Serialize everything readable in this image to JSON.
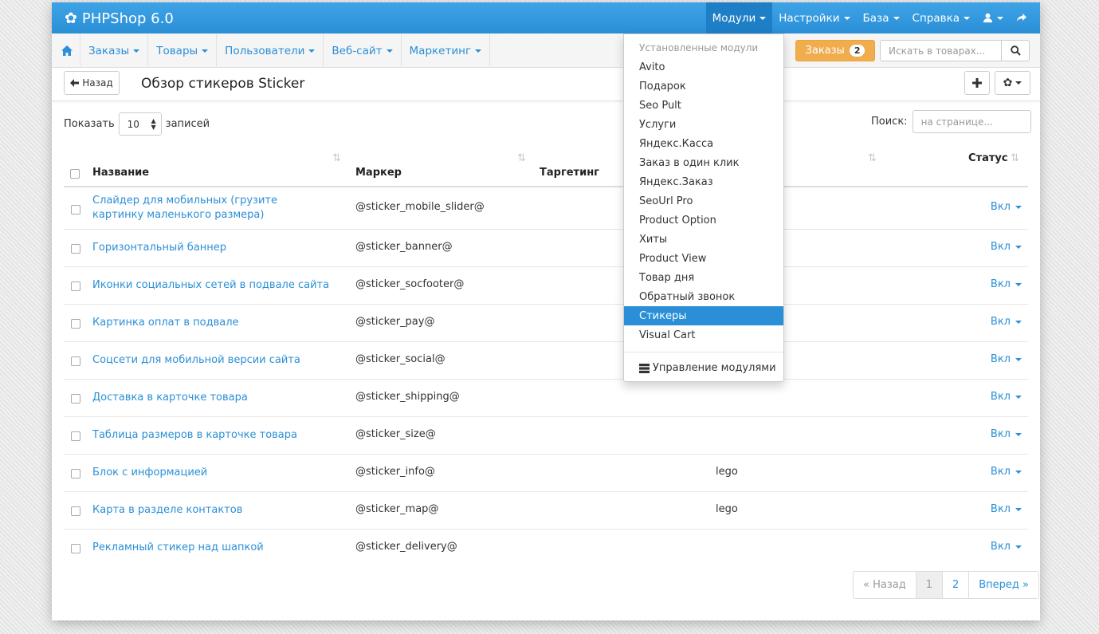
{
  "app": {
    "title": "PHPShop 6.0"
  },
  "topmenu": [
    {
      "label": "Модули",
      "active": true
    },
    {
      "label": "Настройки"
    },
    {
      "label": "База"
    },
    {
      "label": "Справка"
    }
  ],
  "icons": {
    "user": "user-icon",
    "exit": "share-icon",
    "home": "home-icon",
    "search": "search-icon",
    "gear": "gear-icon",
    "plus": "plus-icon",
    "back": "arrow-left-icon",
    "modules": "server-icon"
  },
  "subnav": [
    {
      "label": "Заказы"
    },
    {
      "label": "Товары"
    },
    {
      "label": "Пользователи"
    },
    {
      "label": "Веб-сайт"
    },
    {
      "label": "Маркетинг"
    }
  ],
  "orders_button": {
    "label": "Заказы",
    "count": "2"
  },
  "search": {
    "placeholder": "Искать в товарах..."
  },
  "page": {
    "back_label": "Назад",
    "title": "Обзор стикеров Sticker"
  },
  "controls": {
    "show_label": "Показать",
    "show_value": "10",
    "records_label": "записей",
    "search_label": "Поиск:",
    "search_placeholder": "на странице..."
  },
  "table": {
    "headers": {
      "name": "Название",
      "marker": "Маркер",
      "targeting": "Таргетинг",
      "status": "Статус"
    },
    "rows": [
      {
        "name": "Слайдер для мобильных (грузите картинку маленького размера)",
        "marker": "@sticker_mobile_slider@",
        "targeting": "",
        "status": "Вкл"
      },
      {
        "name": "Горизонтальный баннер",
        "marker": "@sticker_banner@",
        "targeting": "",
        "status": "Вкл"
      },
      {
        "name": "Иконки социальных сетей в подвале сайта",
        "marker": "@sticker_socfooter@",
        "targeting": "",
        "status": "Вкл"
      },
      {
        "name": "Картинка оплат в подвале",
        "marker": "@sticker_pay@",
        "targeting": "",
        "status": "Вкл"
      },
      {
        "name": "Соцсети для мобильной версии сайта",
        "marker": "@sticker_social@",
        "targeting": "",
        "status": "Вкл"
      },
      {
        "name": "Доставка в карточке товара",
        "marker": "@sticker_shipping@",
        "targeting": "",
        "status": "Вкл"
      },
      {
        "name": "Таблица размеров в карточке товара",
        "marker": "@sticker_size@",
        "targeting": "",
        "status": "Вкл"
      },
      {
        "name": "Блок с информацией",
        "marker": "@sticker_info@",
        "targeting": "lego",
        "status": "Вкл"
      },
      {
        "name": "Карта в разделе контактов",
        "marker": "@sticker_map@",
        "targeting": "lego",
        "status": "Вкл"
      },
      {
        "name": "Рекламный стикер над шапкой",
        "marker": "@sticker_delivery@",
        "targeting": "",
        "status": "Вкл"
      }
    ]
  },
  "pagination": {
    "prev": "« Назад",
    "pages": [
      "1",
      "2"
    ],
    "current": "1",
    "next": "Вперед »"
  },
  "modules_dropdown": {
    "header": "Установленные модули",
    "items": [
      {
        "label": "Avito"
      },
      {
        "label": "Подарок"
      },
      {
        "label": "Seo Pult"
      },
      {
        "label": "Услуги"
      },
      {
        "label": "Яндекс.Касса"
      },
      {
        "label": "Заказ в один клик"
      },
      {
        "label": "Яндекс.Заказ"
      },
      {
        "label": "SeoUrl Pro"
      },
      {
        "label": "Product Option"
      },
      {
        "label": "Хиты"
      },
      {
        "label": "Product View"
      },
      {
        "label": "Товар дня"
      },
      {
        "label": "Обратный звонок"
      },
      {
        "label": "Стикеры",
        "active": true
      },
      {
        "label": "Visual Cart"
      }
    ],
    "manage_label": "Управление модулями"
  },
  "colors": {
    "primary": "#2a8fd6",
    "warning": "#f0ad4e"
  }
}
